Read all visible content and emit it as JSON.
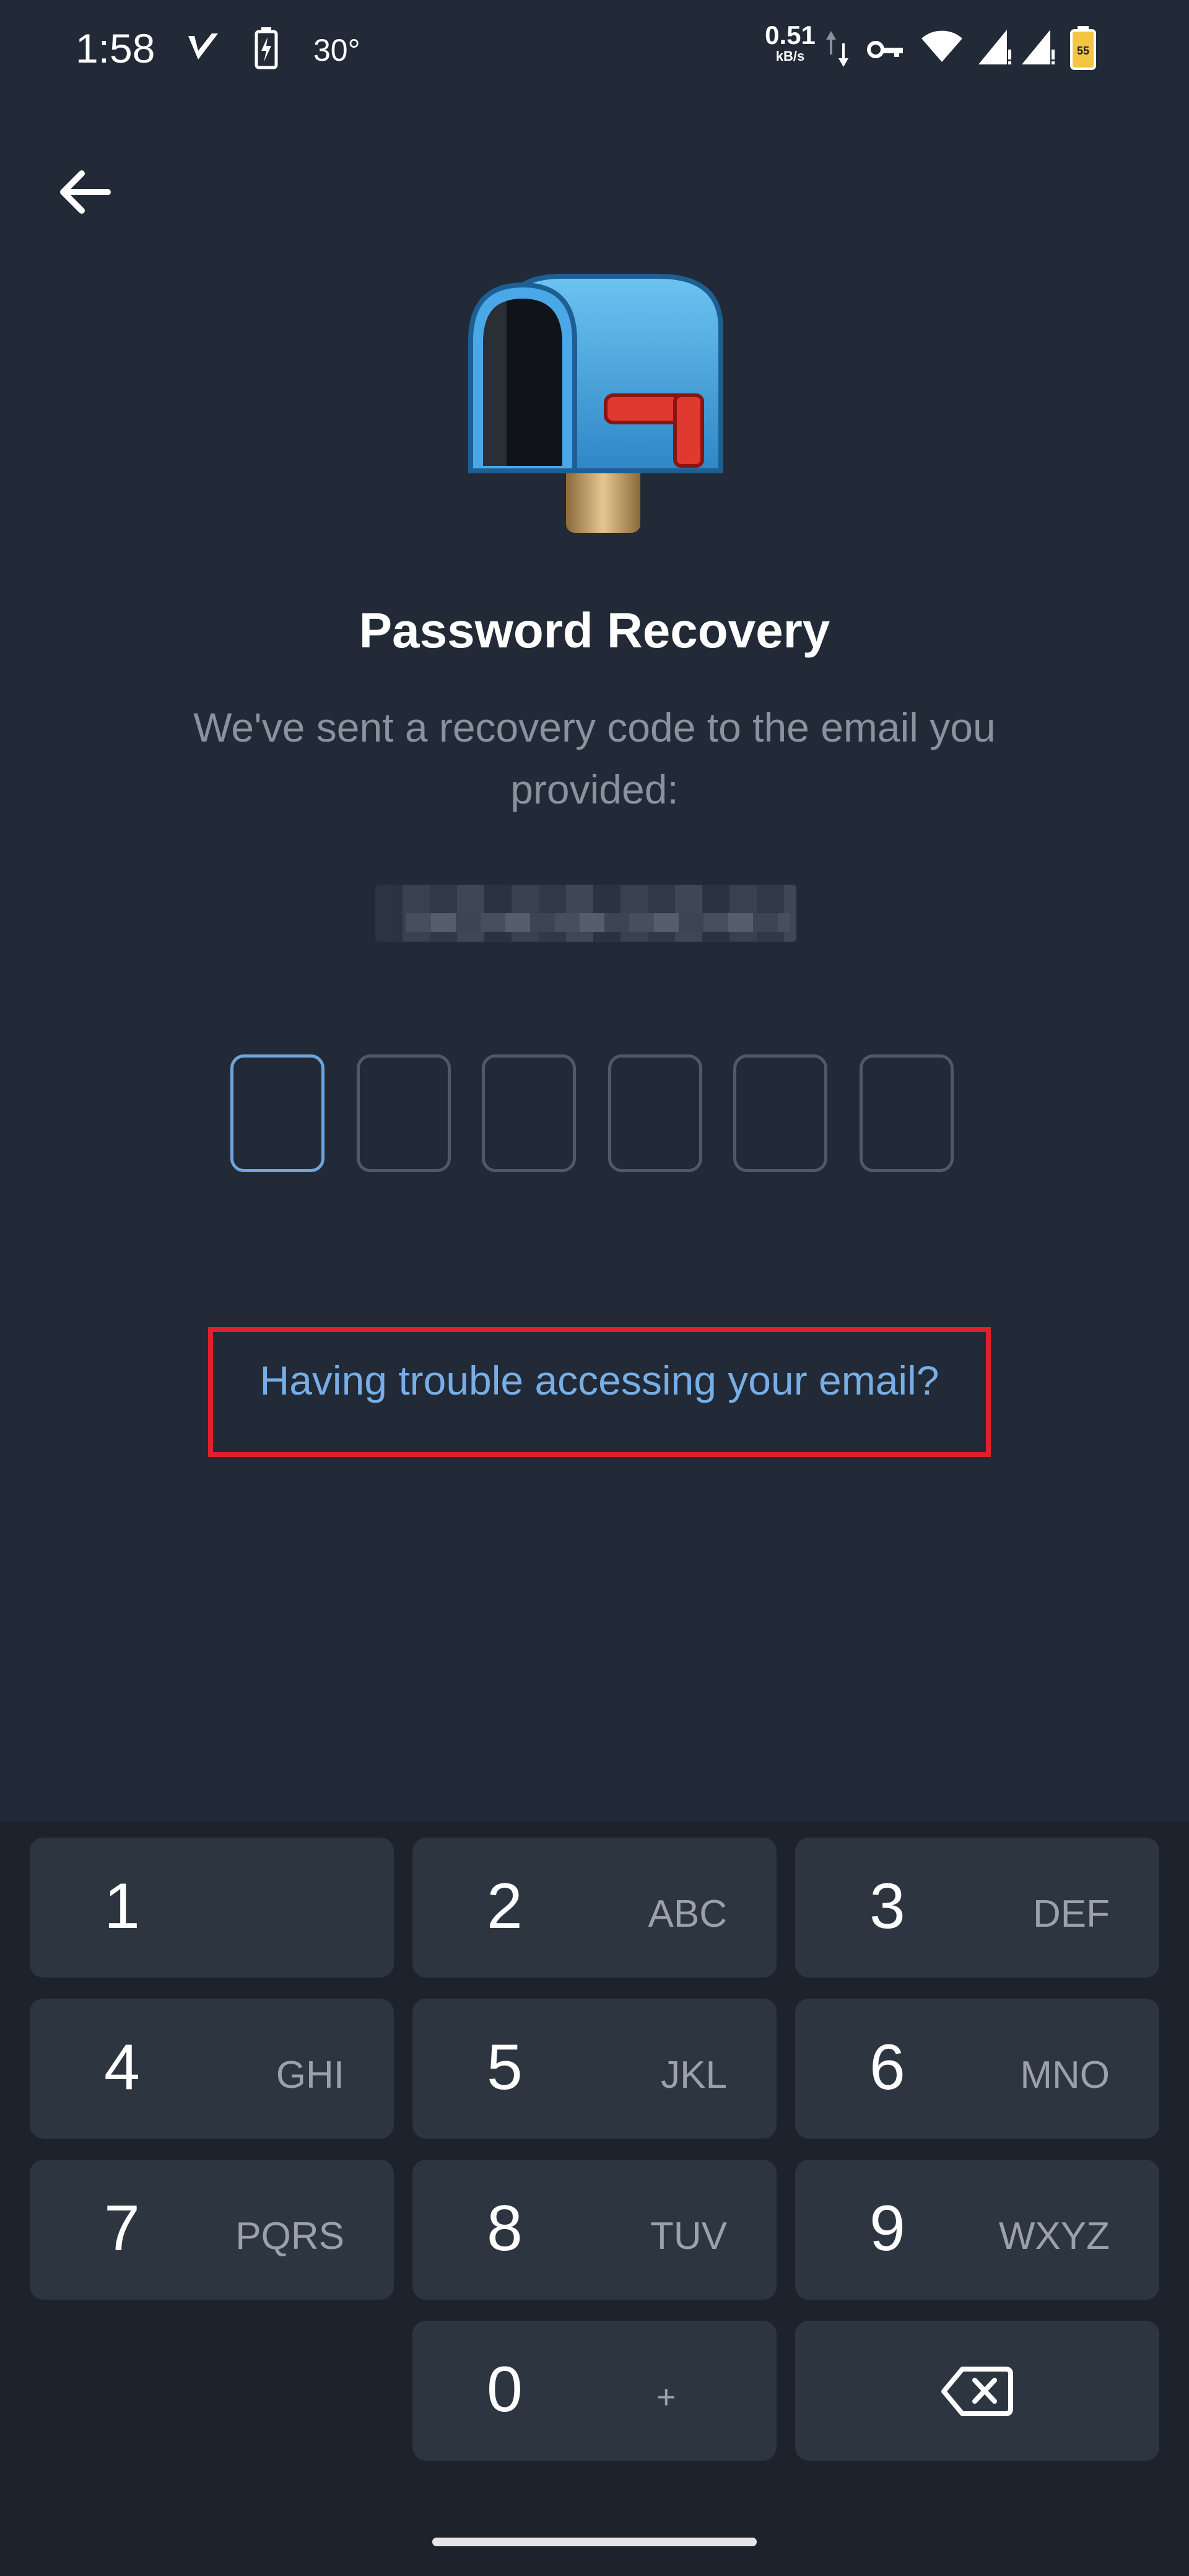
{
  "status_bar": {
    "time": "1:58",
    "temperature": "30°",
    "net_speed_value": "0.51",
    "net_speed_unit": "kB/s",
    "battery_level": "55",
    "icons": [
      "checkmark-app-icon",
      "battery-saver-icon",
      "data-up-down-icon",
      "vpn-key-icon",
      "wifi-icon",
      "signal-icon",
      "signal-icon",
      "battery-icon"
    ]
  },
  "header": {
    "back_icon": "arrow-left-icon"
  },
  "hero": {
    "icon": "mailbox-icon"
  },
  "title": "Password Recovery",
  "subtitle": "We've sent a recovery code to the email you provided:",
  "code_input": {
    "length": 6,
    "active_index": 0
  },
  "trouble_link": "Having trouble accessing your email?",
  "keypad": {
    "keys": [
      {
        "num": "1",
        "letters": ""
      },
      {
        "num": "2",
        "letters": "ABC"
      },
      {
        "num": "3",
        "letters": "DEF"
      },
      {
        "num": "4",
        "letters": "GHI"
      },
      {
        "num": "5",
        "letters": "JKL"
      },
      {
        "num": "6",
        "letters": "MNO"
      },
      {
        "num": "7",
        "letters": "PQRS"
      },
      {
        "num": "8",
        "letters": "TUV"
      },
      {
        "num": "9",
        "letters": "WXYZ"
      },
      {
        "num": "0",
        "letters": "+"
      }
    ],
    "backspace_icon": "backspace-icon"
  },
  "colors": {
    "background": "#212a36",
    "keypad_background": "#1c232d",
    "key": "#2d3541",
    "accent": "#78aee6",
    "highlight": "#e0202a"
  }
}
